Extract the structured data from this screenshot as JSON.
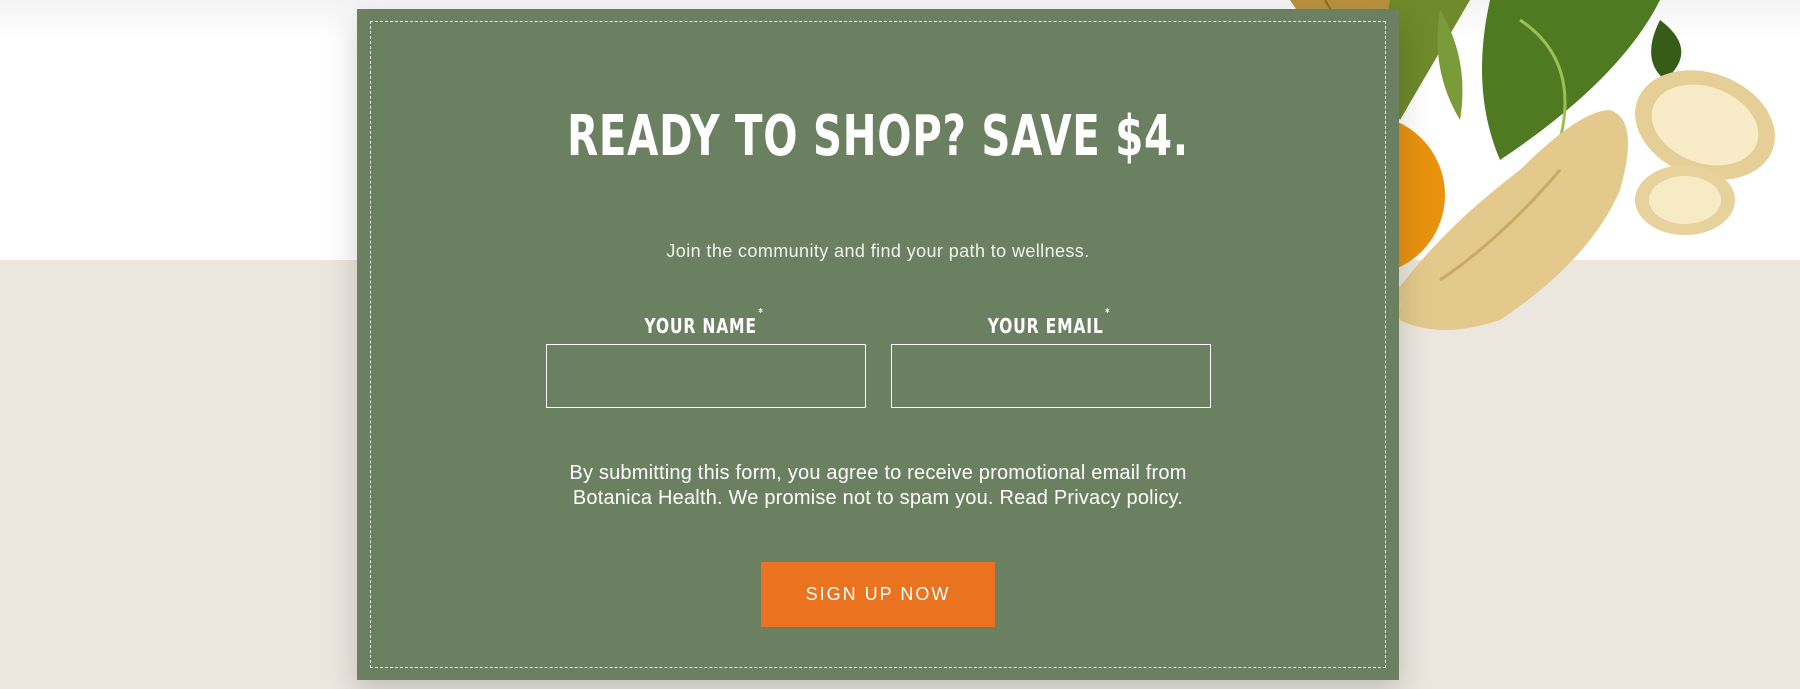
{
  "promo": {
    "headline": "READY TO SHOP? SAVE $4.",
    "subtitle": "Join the community and find your path to wellness.",
    "name_label": "YOUR NAME",
    "email_label": "YOUR EMAIL",
    "required_marker": "*",
    "name_value": "",
    "email_value": "",
    "consent_text": "By submitting this form, you agree to receive promotional email from Botanica Health. We promise not to spam you. Read Privacy policy.",
    "button_label": "SIGN UP NOW"
  },
  "decor": {
    "image": "physalis-and-ginseng-root",
    "colors": {
      "card": "#6b8061",
      "button": "#e9731e",
      "page_bottom": "#ebe7df"
    }
  }
}
